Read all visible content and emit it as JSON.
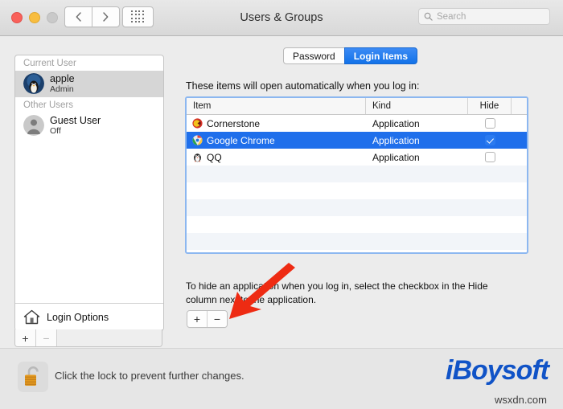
{
  "window": {
    "title": "Users & Groups",
    "traffic_lights": [
      "close-red",
      "minimize-yellow",
      "zoom-disabled-gray"
    ],
    "back_label": "‹",
    "forward_label": "›",
    "grid_button_name": "show-all-preferences"
  },
  "search": {
    "placeholder": "Search",
    "value": ""
  },
  "sidebar": {
    "groups": [
      {
        "header": "Current User",
        "users": [
          {
            "name": "apple",
            "status": "Admin",
            "selected": true,
            "avatar": "penguin-avatar"
          }
        ]
      },
      {
        "header": "Other Users",
        "users": [
          {
            "name": "Guest User",
            "status": "Off",
            "selected": false,
            "avatar": "person-avatar"
          }
        ]
      }
    ],
    "login_options_label": "Login Options",
    "add_label": "+",
    "remove_label": "−"
  },
  "tabs": [
    {
      "label": "Password",
      "active": false
    },
    {
      "label": "Login Items",
      "active": true
    }
  ],
  "main": {
    "description": "These items will open automatically when you log in:",
    "columns": [
      "Item",
      "Kind",
      "Hide"
    ],
    "rows": [
      {
        "item": "Cornerstone",
        "kind": "Application",
        "hide": false,
        "selected": false,
        "icon": "cornerstone-icon"
      },
      {
        "item": "Google Chrome",
        "kind": "Application",
        "hide": true,
        "selected": true,
        "icon": "chrome-icon"
      },
      {
        "item": "QQ",
        "kind": "Application",
        "hide": false,
        "selected": false,
        "icon": "qq-penguin-icon"
      }
    ],
    "empty_row_count": 6,
    "hint": "To hide an application when you log in, select the checkbox in the Hide column next to the application.",
    "add_label": "+",
    "remove_label": "−"
  },
  "footer": {
    "lock_text": "Click the lock to prevent further changes.",
    "lock_state": "unlocked"
  },
  "watermark": {
    "brand": "iBoysoft",
    "site": "wsxdn.com"
  },
  "annotation": {
    "type": "red-arrow",
    "points_to": "add-remove-login-item-buttons"
  },
  "colors": {
    "accent_blue": "#1f6feb",
    "tab_active": "#1272e8",
    "table_focus_border": "#8cb7f0",
    "brand_blue": "#1053c7",
    "arrow_red": "#ee2b13"
  }
}
